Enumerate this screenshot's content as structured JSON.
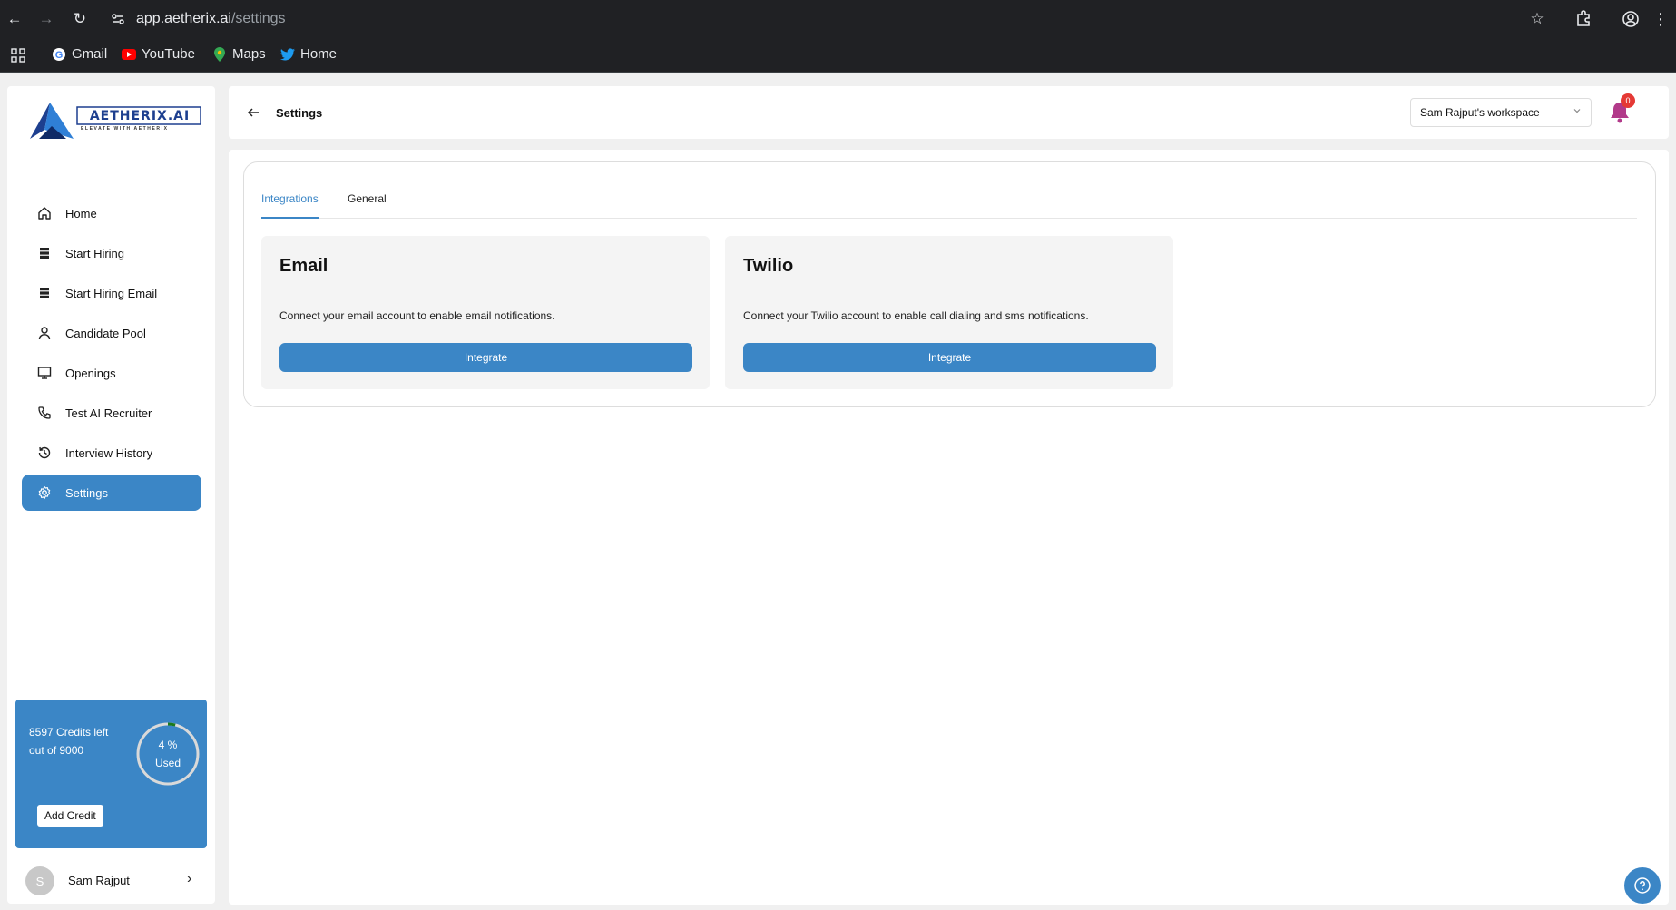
{
  "browser": {
    "url_host": "app.aetherix.ai",
    "url_path": "/settings",
    "bookmarks": [
      {
        "label": "Gmail",
        "icon": "google-icon"
      },
      {
        "label": "YouTube",
        "icon": "youtube-icon"
      },
      {
        "label": "Maps",
        "icon": "maps-icon"
      },
      {
        "label": "Home",
        "icon": "twitter-icon"
      }
    ]
  },
  "sidebar": {
    "logo_text": "AETHERIX.AI",
    "logo_tagline": "ELEVATE WITH AETHERIX",
    "items": [
      {
        "label": "Home",
        "icon": "home-icon"
      },
      {
        "label": "Start Hiring",
        "icon": "list-icon"
      },
      {
        "label": "Start Hiring Email",
        "icon": "list-icon"
      },
      {
        "label": "Candidate Pool",
        "icon": "user-icon"
      },
      {
        "label": "Openings",
        "icon": "monitor-icon"
      },
      {
        "label": "Test AI Recruiter",
        "icon": "phone-icon"
      },
      {
        "label": "Interview History",
        "icon": "history-icon"
      },
      {
        "label": "Settings",
        "icon": "gear-icon",
        "active": true
      }
    ],
    "credits": {
      "line1": "8597 Credits left",
      "line2": "out of 9000",
      "percent_label": "4 %",
      "used_label": "Used",
      "used_fraction": 0.04,
      "add_label": "Add Credit"
    },
    "user": {
      "initial": "S",
      "name": "Sam Rajput"
    }
  },
  "header": {
    "title": "Settings",
    "workspace": "Sam Rajput's workspace",
    "notification_count": "0"
  },
  "main": {
    "tabs": [
      {
        "label": "Integrations",
        "active": true
      },
      {
        "label": "General",
        "active": false
      }
    ],
    "cards": [
      {
        "title": "Email",
        "description": "Connect your email account to enable email notifications.",
        "button": "Integrate"
      },
      {
        "title": "Twilio",
        "description": "Connect your Twilio account to enable call dialing and sms notifications.",
        "button": "Integrate"
      }
    ]
  },
  "colors": {
    "accent": "#3b86c6",
    "badge": "#e53935",
    "chrome": "#202124"
  }
}
